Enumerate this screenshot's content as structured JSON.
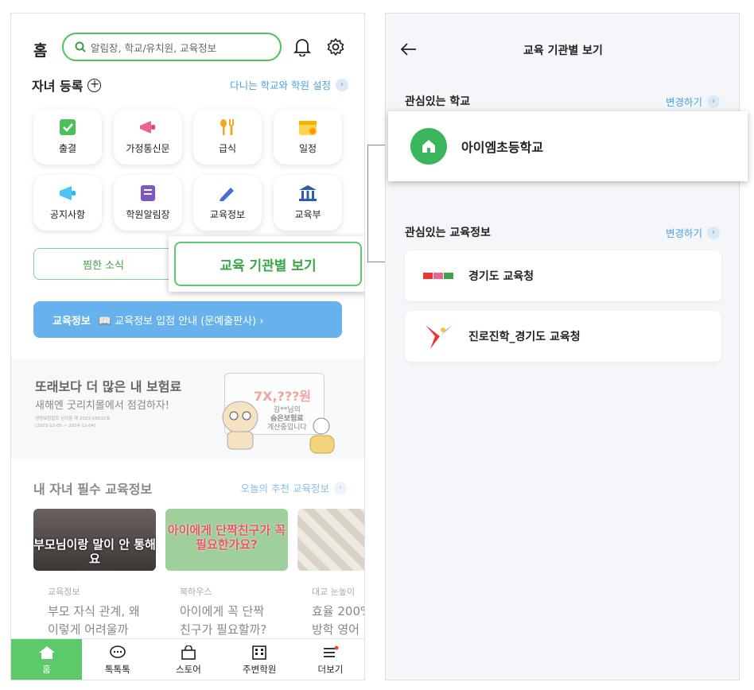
{
  "left": {
    "header": {
      "title": "홈",
      "search_placeholder": "알림장, 학교/유치원, 교육정보"
    },
    "children": {
      "label": "자녀 등록",
      "setting_link": "다니는 학교와 학원 설정"
    },
    "menu": [
      {
        "label": "출결",
        "icon": "check-board-icon"
      },
      {
        "label": "가정통신문",
        "icon": "megaphone-icon"
      },
      {
        "label": "급식",
        "icon": "utensils-icon"
      },
      {
        "label": "일정",
        "icon": "calendar-icon"
      },
      {
        "label": "공지사항",
        "icon": "announce-icon"
      },
      {
        "label": "학원알림장",
        "icon": "notebook-icon"
      },
      {
        "label": "교육정보",
        "icon": "pencil-icon"
      },
      {
        "label": "교육부",
        "icon": "building-icon"
      }
    ],
    "scrap_button": "찜한 소식",
    "institution_button": "교육 기관별 보기",
    "banner": {
      "tag": "교육정보",
      "text": "📖 교육정보 입점 안내 (문예출판사) ›"
    },
    "ad": {
      "title": "또래보다 더 많은 내 보험료",
      "subtitle": "새해엔 굿리치몰에서 점검하자!",
      "fine1": "생명보험협회 심의필 제 2023-05632호",
      "fine2": "(2023-12-05 ~ 2024-12-04)",
      "amount": "7X,???원",
      "line1": "김**님의",
      "line2": "숨은보험료",
      "line3": "계산중입니다"
    },
    "section": {
      "title": "내 자녀 필수 교육정보",
      "link": "오늘의 추천 교육정보"
    },
    "cards": [
      {
        "thumb": "부모님이랑 말이 안 통해요",
        "category": "교육정보",
        "title1": "부모 자식 관계, 왜",
        "title2": "이렇게 어려울까"
      },
      {
        "thumb": "아이에게 단짝친구가 꼭 필요한가요?",
        "category": "북하우스",
        "title1": "아이에게 꼭 단짝",
        "title2": "친구가 필요할까?"
      },
      {
        "thumb": "",
        "category": "대교 눈높이",
        "title1": "효율 200%",
        "title2": "방학 영어"
      }
    ],
    "tabs": [
      {
        "label": "홈",
        "icon": "home-icon",
        "active": true
      },
      {
        "label": "톡톡톡",
        "icon": "chat-icon"
      },
      {
        "label": "스토어",
        "icon": "bag-icon"
      },
      {
        "label": "주변학원",
        "icon": "academy-icon"
      },
      {
        "label": "더보기",
        "icon": "menu-icon"
      }
    ]
  },
  "right": {
    "title": "교육 기관별 보기",
    "school_section": {
      "title": "관심있는 학교",
      "link": "변경하기"
    },
    "school": "아이엠초등학교",
    "info_section": {
      "title": "관심있는 교육정보",
      "link": "변경하기"
    },
    "info": [
      {
        "name": "경기도 교육청",
        "icon": "gyeonggi-edu-logo"
      },
      {
        "name": "진로진학_경기도 교육청",
        "icon": "career-logo"
      }
    ]
  },
  "colors": {
    "green": "#5cc96a",
    "blue_link": "#4aa3df",
    "banner": "#67b2ec"
  }
}
